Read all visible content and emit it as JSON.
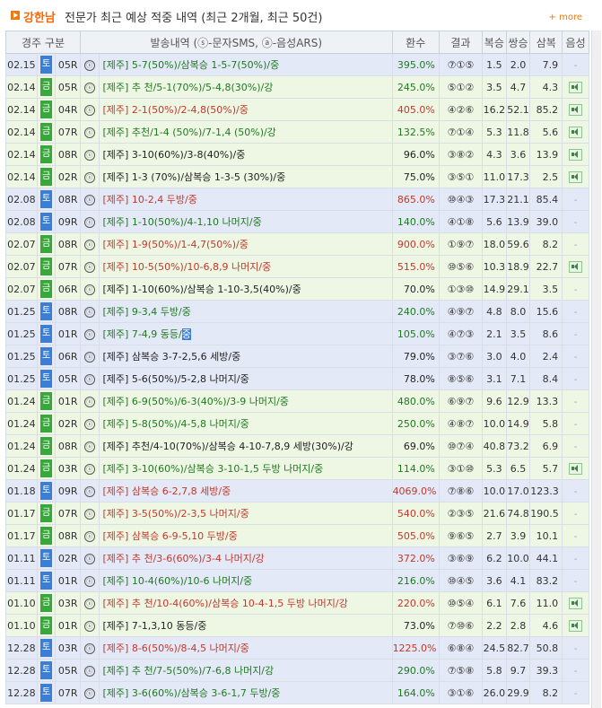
{
  "header": {
    "name": "강한남",
    "desc": "전문가 최근 예상 적중 내역 (최근 2개월, 최근 50건)",
    "more": "+ more"
  },
  "columns": [
    "경주 구분",
    "발송내역 (ⓢ-문자SMS, ⓐ-음성ARS)",
    "환수",
    "결과",
    "복승",
    "쌍승",
    "삼복",
    "음성"
  ],
  "colors": {
    "sat": "#3a7fd5",
    "fri": "#37a83a",
    "green_text": "#1f7a1f",
    "red_text": "#c0392b",
    "row_green": "#eef7e4",
    "row_blue": "#e4e9f7"
  },
  "rows": [
    {
      "date": "02.15",
      "day": "토",
      "race": "05R",
      "mode": "ⓢ",
      "prefix": "[제주]",
      "text": "5-7(50%)/삼복승 1-5-7(50%)/중",
      "color": "green",
      "payout": "395.0%",
      "result": "⑦①⑤",
      "bok": "1.5",
      "ssang": "2.0",
      "sambok": "7.9",
      "voice": "-",
      "bg": "#e4e9f7"
    },
    {
      "date": "02.14",
      "day": "금",
      "race": "05R",
      "mode": "ⓢ",
      "prefix": "[제주]",
      "text": "추 천/5-1(70%)/5-4,8(30%)/강",
      "color": "green",
      "payout": "245.0%",
      "result": "⑤①②",
      "bok": "3.5",
      "ssang": "4.7",
      "sambok": "4.3",
      "voice": "spk",
      "bg": "#eef7e4"
    },
    {
      "date": "02.14",
      "day": "금",
      "race": "04R",
      "mode": "ⓢ",
      "prefix": "[제주]",
      "text": "2-1(50%)/2-4,8(50%)/중",
      "color": "red",
      "payout": "405.0%",
      "result": "④②⑥",
      "bok": "16.2",
      "ssang": "52.1",
      "sambok": "85.2",
      "voice": "spk",
      "bg": "#eef7e4"
    },
    {
      "date": "02.14",
      "day": "금",
      "race": "07R",
      "mode": "ⓢ",
      "prefix": "[제주]",
      "text": "추천/1-4 (50%)/7-1,4 (50%)/강",
      "color": "green",
      "payout": "132.5%",
      "result": "⑦①④",
      "bok": "5.3",
      "ssang": "11.8",
      "sambok": "5.6",
      "voice": "spk",
      "bg": "#eef7e4"
    },
    {
      "date": "02.14",
      "day": "금",
      "race": "08R",
      "mode": "ⓢ",
      "prefix": "[제주]",
      "text": "3-10(60%)/3-8(40%)/중",
      "color": "black",
      "payout": "96.0%",
      "result": "③⑧②",
      "bok": "4.3",
      "ssang": "3.6",
      "sambok": "13.9",
      "voice": "spk",
      "bg": "#eef7e4"
    },
    {
      "date": "02.14",
      "day": "금",
      "race": "02R",
      "mode": "ⓢ",
      "prefix": "[제주]",
      "text": "1-3 (70%)/삼복승 1-3-5 (30%)/중",
      "color": "black",
      "payout": "75.0%",
      "result": "③⑤①",
      "bok": "11.0",
      "ssang": "17.3",
      "sambok": "2.5",
      "voice": "spk",
      "bg": "#eef7e4"
    },
    {
      "date": "02.08",
      "day": "토",
      "race": "08R",
      "mode": "ⓢ",
      "prefix": "[제주]",
      "text": "10-2,4 두방/중",
      "color": "red",
      "payout": "865.0%",
      "result": "⑩④③",
      "bok": "17.3",
      "ssang": "21.1",
      "sambok": "85.4",
      "voice": "-",
      "bg": "#e4e9f7"
    },
    {
      "date": "02.08",
      "day": "토",
      "race": "09R",
      "mode": "ⓢ",
      "prefix": "[제주]",
      "text": "1-10(50%)/4-1,10 나머지/중",
      "color": "green",
      "payout": "140.0%",
      "result": "④①⑧",
      "bok": "5.6",
      "ssang": "13.9",
      "sambok": "39.0",
      "voice": "-",
      "bg": "#e4e9f7"
    },
    {
      "date": "02.07",
      "day": "금",
      "race": "08R",
      "mode": "ⓢ",
      "prefix": "[제주]",
      "text": "1-9(50%)/1-4,7(50%)/중",
      "color": "red",
      "payout": "900.0%",
      "result": "①⑨⑦",
      "bok": "18.0",
      "ssang": "59.6",
      "sambok": "8.2",
      "voice": "-",
      "bg": "#eef7e4"
    },
    {
      "date": "02.07",
      "day": "금",
      "race": "07R",
      "mode": "ⓢ",
      "prefix": "[제주]",
      "text": "10-5(50%)/10-6,8,9 나머지/중",
      "color": "red",
      "payout": "515.0%",
      "result": "⑩⑤⑥",
      "bok": "10.3",
      "ssang": "18.9",
      "sambok": "22.7",
      "voice": "spk",
      "bg": "#eef7e4"
    },
    {
      "date": "02.07",
      "day": "금",
      "race": "06R",
      "mode": "ⓢ",
      "prefix": "[제주]",
      "text": "1-10(60%)/삼복승 1-10-3,5(40%)/중",
      "color": "black",
      "payout": "70.0%",
      "result": "①③⑩",
      "bok": "14.9",
      "ssang": "29.1",
      "sambok": "3.5",
      "voice": "-",
      "bg": "#eef7e4"
    },
    {
      "date": "01.25",
      "day": "토",
      "race": "08R",
      "mode": "ⓢ",
      "prefix": "[제주]",
      "text": "9-3,4 두방/중",
      "color": "green",
      "payout": "240.0%",
      "result": "④⑨⑦",
      "bok": "4.8",
      "ssang": "8.0",
      "sambok": "15.6",
      "voice": "-",
      "bg": "#e4e9f7"
    },
    {
      "date": "01.25",
      "day": "토",
      "race": "01R",
      "mode": "ⓢ",
      "prefix": "[제주]",
      "text": "7-4,9 동등/",
      "tail": "중",
      "color": "green",
      "payout": "105.0%",
      "result": "④⑦③",
      "bok": "2.1",
      "ssang": "3.5",
      "sambok": "8.6",
      "voice": "-",
      "bg": "#e4e9f7"
    },
    {
      "date": "01.25",
      "day": "토",
      "race": "06R",
      "mode": "ⓢ",
      "prefix": "[제주]",
      "text": "삼복승 3-7-2,5,6 세방/중",
      "color": "black",
      "payout": "79.0%",
      "result": "③⑦⑥",
      "bok": "3.0",
      "ssang": "4.0",
      "sambok": "2.4",
      "voice": "-",
      "bg": "#e4e9f7"
    },
    {
      "date": "01.25",
      "day": "토",
      "race": "05R",
      "mode": "ⓢ",
      "prefix": "[제주]",
      "text": "5-6(50%)/5-2,8 나머지/중",
      "color": "black",
      "payout": "78.0%",
      "result": "⑧⑤⑥",
      "bok": "3.1",
      "ssang": "7.1",
      "sambok": "8.4",
      "voice": "-",
      "bg": "#e4e9f7"
    },
    {
      "date": "01.24",
      "day": "금",
      "race": "01R",
      "mode": "ⓢ",
      "prefix": "[제주]",
      "text": "6-9(50%)/6-3(40%)/3-9 나머지/중",
      "color": "green",
      "payout": "480.0%",
      "result": "⑥⑨⑦",
      "bok": "9.6",
      "ssang": "12.9",
      "sambok": "13.3",
      "voice": "-",
      "bg": "#eef7e4"
    },
    {
      "date": "01.24",
      "day": "금",
      "race": "02R",
      "mode": "ⓢ",
      "prefix": "[제주]",
      "text": "5-8(50%)/4-5,8 나머지/중",
      "color": "green",
      "payout": "250.0%",
      "result": "④⑧⑦",
      "bok": "10.0",
      "ssang": "14.9",
      "sambok": "5.8",
      "voice": "-",
      "bg": "#eef7e4"
    },
    {
      "date": "01.24",
      "day": "금",
      "race": "08R",
      "mode": "ⓢ",
      "prefix": "[제주]",
      "text": "추천/4-10(70%)/삼복승 4-10-7,8,9 세방(30%)/강",
      "color": "black",
      "payout": "69.0%",
      "result": "⑩⑦④",
      "bok": "40.8",
      "ssang": "73.2",
      "sambok": "6.9",
      "voice": "-",
      "bg": "#eef7e4"
    },
    {
      "date": "01.24",
      "day": "금",
      "race": "03R",
      "mode": "ⓢ",
      "prefix": "[제주]",
      "text": "3-10(60%)/삼복승 3-10-1,5 두방 나머지/중",
      "color": "green",
      "payout": "114.0%",
      "result": "③①⑩",
      "bok": "5.3",
      "ssang": "6.5",
      "sambok": "5.7",
      "voice": "spk",
      "bg": "#eef7e4"
    },
    {
      "date": "01.18",
      "day": "토",
      "race": "09R",
      "mode": "ⓢ",
      "prefix": "[제주]",
      "text": "삼복승 6-2,7,8 세방/중",
      "color": "red",
      "payout": "4069.0%",
      "result": "⑦⑧⑥",
      "bok": "10.0",
      "ssang": "17.0",
      "sambok": "123.3",
      "voice": "-",
      "bg": "#e4e9f7"
    },
    {
      "date": "01.17",
      "day": "금",
      "race": "07R",
      "mode": "ⓢ",
      "prefix": "[제주]",
      "text": "3-5(50%)/2-3,5 나머지/중",
      "color": "red",
      "payout": "540.0%",
      "result": "②③⑤",
      "bok": "21.6",
      "ssang": "74.8",
      "sambok": "190.5",
      "voice": "-",
      "bg": "#eef7e4"
    },
    {
      "date": "01.17",
      "day": "금",
      "race": "08R",
      "mode": "ⓢ",
      "prefix": "[제주]",
      "text": "삼복승 6-9-5,10 두방/중",
      "color": "red",
      "payout": "505.0%",
      "result": "⑨⑥⑤",
      "bok": "2.7",
      "ssang": "3.9",
      "sambok": "10.1",
      "voice": "-",
      "bg": "#eef7e4"
    },
    {
      "date": "01.11",
      "day": "토",
      "race": "02R",
      "mode": "ⓢ",
      "prefix": "[제주]",
      "text": "추 천/3-6(60%)/3-4 나머지/강",
      "color": "red",
      "payout": "372.0%",
      "result": "③⑥⑨",
      "bok": "6.2",
      "ssang": "10.0",
      "sambok": "44.1",
      "voice": "-",
      "bg": "#e4e9f7"
    },
    {
      "date": "01.11",
      "day": "토",
      "race": "01R",
      "mode": "ⓢ",
      "prefix": "[제주]",
      "text": "10-4(60%)/10-6 나머지/중",
      "color": "green",
      "payout": "216.0%",
      "result": "⑩④⑤",
      "bok": "3.6",
      "ssang": "4.1",
      "sambok": "83.2",
      "voice": "-",
      "bg": "#e4e9f7"
    },
    {
      "date": "01.10",
      "day": "금",
      "race": "03R",
      "mode": "ⓢ",
      "prefix": "[제주]",
      "text": "추 천/10-4(60%)/삼복승 10-4-1,5 두방 나머지/강",
      "color": "red",
      "payout": "220.0%",
      "result": "⑩⑤④",
      "bok": "6.1",
      "ssang": "7.6",
      "sambok": "11.0",
      "voice": "spk",
      "bg": "#eef7e4"
    },
    {
      "date": "01.10",
      "day": "금",
      "race": "01R",
      "mode": "ⓢ",
      "prefix": "[제주]",
      "text": "7-1,3,10 동등/중",
      "color": "black",
      "payout": "73.0%",
      "result": "⑦⑩⑥",
      "bok": "2.2",
      "ssang": "2.8",
      "sambok": "4.6",
      "voice": "spk",
      "bg": "#eef7e4"
    },
    {
      "date": "12.28",
      "day": "토",
      "race": "03R",
      "mode": "ⓢ",
      "prefix": "[제주]",
      "text": "8-6(50%)/8-4,5 나머지/중",
      "color": "red",
      "payout": "1225.0%",
      "result": "⑥⑧④",
      "bok": "24.5",
      "ssang": "82.7",
      "sambok": "50.8",
      "voice": "-",
      "bg": "#e4e9f7"
    },
    {
      "date": "12.28",
      "day": "토",
      "race": "05R",
      "mode": "ⓢ",
      "prefix": "[제주]",
      "text": "추 천/7-5(50%)/7-6,8 나머지/강",
      "color": "green",
      "payout": "290.0%",
      "result": "⑦⑤⑧",
      "bok": "5.8",
      "ssang": "9.7",
      "sambok": "39.3",
      "voice": "-",
      "bg": "#e4e9f7"
    },
    {
      "date": "12.28",
      "day": "토",
      "race": "07R",
      "mode": "ⓢ",
      "prefix": "[제주]",
      "text": "3-6(60%)/삼복승 3-6-1,7 두방/중",
      "color": "green",
      "payout": "164.0%",
      "result": "③①⑥",
      "bok": "26.0",
      "ssang": "29.9",
      "sambok": "8.2",
      "voice": "-",
      "bg": "#e4e9f7"
    }
  ]
}
